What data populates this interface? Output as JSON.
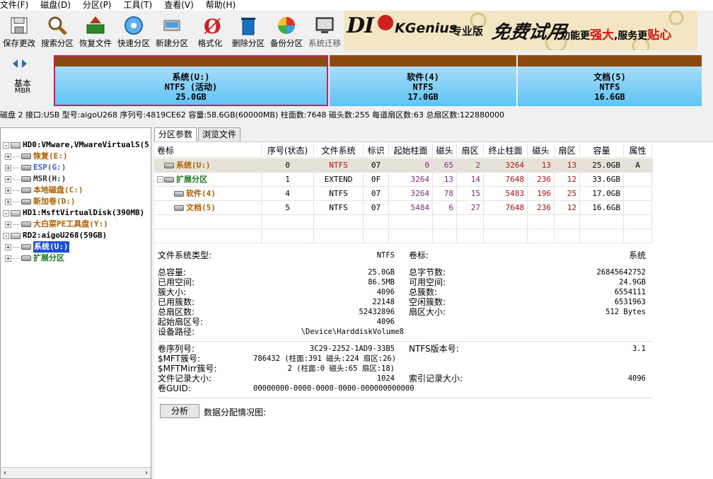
{
  "menu": [
    "文件(F)",
    "磁盘(D)",
    "分区(P)",
    "工具(T)",
    "查看(V)",
    "帮助(H)"
  ],
  "toolbar": [
    {
      "label": "保存更改",
      "icon": "save-icon",
      "disabled": false
    },
    {
      "label": "搜索分区",
      "icon": "search-icon",
      "disabled": false
    },
    {
      "label": "恢复文件",
      "icon": "recover-icon",
      "disabled": false
    },
    {
      "label": "快速分区",
      "icon": "quick-partition-icon",
      "disabled": false
    },
    {
      "label": "新建分区",
      "icon": "new-partition-icon",
      "disabled": false
    },
    {
      "label": "格式化",
      "icon": "format-icon",
      "disabled": false
    },
    {
      "label": "删除分区",
      "icon": "delete-icon",
      "disabled": false
    },
    {
      "label": "备份分区",
      "icon": "backup-icon",
      "disabled": false
    },
    {
      "label": "系统迁移",
      "icon": "migrate-icon",
      "disabled": true
    }
  ],
  "banner": {
    "brand_a": "DI",
    "brand_b": "KGenius",
    "edition": "专业版",
    "free": "免费试用",
    "slogan_a": "功能更",
    "slogan_b": "强大",
    "slogan_c": ",服务更",
    "slogan_d": "贴心"
  },
  "disk_type": {
    "line1": "基本",
    "line2": "MBR"
  },
  "partitions": [
    {
      "name": "系统(U:)",
      "fs": "NTFS (活动)",
      "size": "25.0GB",
      "selected": true
    },
    {
      "name": "软件(4)",
      "fs": "NTFS",
      "size": "17.0GB",
      "selected": false
    },
    {
      "name": "文档(5)",
      "fs": "NTFS",
      "size": "16.6GB",
      "selected": false
    }
  ],
  "disk_info": "磁盘 2 接口:USB  型号:aigoU268  序列号:4819CE62  容量:58.6GB(60000MB)  柱面数:7648  磁头数:255  每道扇区数:63  总扇区数:122880000",
  "tree": [
    {
      "text": "HD0:VMware,VMwareVirtualS(5",
      "type": "disk",
      "indent": 0,
      "exp": "-",
      "color": "#000"
    },
    {
      "text": "恢复(E:)",
      "type": "part",
      "indent": 1,
      "exp": "+",
      "color": "#b06000"
    },
    {
      "text": "ESP(G:)",
      "type": "part",
      "indent": 1,
      "exp": "+",
      "color": "#3a62d8"
    },
    {
      "text": "MSR(H:)",
      "type": "part",
      "indent": 1,
      "exp": "+",
      "color": "#333"
    },
    {
      "text": "本地磁盘(C:)",
      "type": "part",
      "indent": 1,
      "exp": "+",
      "color": "#b06000"
    },
    {
      "text": "新加卷(D:)",
      "type": "part",
      "indent": 1,
      "exp": "+",
      "color": "#b06000"
    },
    {
      "text": "HD1:MsftVirtualDisk(390MB)",
      "type": "disk",
      "indent": 0,
      "exp": "-",
      "color": "#000"
    },
    {
      "text": "大白菜PE工具盘(Y:)",
      "type": "part",
      "indent": 1,
      "exp": "+",
      "color": "#b06000"
    },
    {
      "text": "RD2:aigoU268(59GB)",
      "type": "disk",
      "indent": 0,
      "exp": "-",
      "color": "#000"
    },
    {
      "text": "系统(U:)",
      "type": "part",
      "indent": 1,
      "exp": "+",
      "color": "#fff",
      "selected": true
    },
    {
      "text": "扩展分区",
      "type": "part",
      "indent": 1,
      "exp": "+",
      "color": "#1a7a1a"
    }
  ],
  "tabs": [
    "分区参数",
    "浏览文件"
  ],
  "table": {
    "headers": [
      "卷标",
      "序号(状态)",
      "文件系统",
      "标识",
      "起始柱面",
      "磁头",
      "扇区",
      "终止柱面",
      "磁头",
      "扇区",
      "容量",
      "属性"
    ],
    "rows": [
      {
        "label": "系统(U:)",
        "indent": 0,
        "seq": "0",
        "fs": "NTFS",
        "id": "07",
        "sc": "0",
        "sh": "65",
        "ss": "2",
        "ec": "3264",
        "eh": "13",
        "es": "13",
        "cap": "25.0GB",
        "attr": "A",
        "color": "#b06000",
        "selected": true
      },
      {
        "label": "扩展分区",
        "indent": 0,
        "seq": "1",
        "fs": "EXTEND",
        "id": "0F",
        "sc": "3264",
        "sh": "13",
        "ss": "14",
        "ec": "7648",
        "eh": "236",
        "es": "12",
        "cap": "33.6GB",
        "attr": "",
        "color": "#1a7a1a",
        "selected": false
      },
      {
        "label": "软件(4)",
        "indent": 1,
        "seq": "4",
        "fs": "NTFS",
        "id": "07",
        "sc": "3264",
        "sh": "78",
        "ss": "15",
        "ec": "5483",
        "eh": "196",
        "es": "25",
        "cap": "17.0GB",
        "attr": "",
        "color": "#b06000",
        "selected": false
      },
      {
        "label": "文档(5)",
        "indent": 1,
        "seq": "5",
        "fs": "NTFS",
        "id": "07",
        "sc": "5484",
        "sh": "6",
        "ss": "27",
        "ec": "7648",
        "eh": "236",
        "es": "12",
        "cap": "16.6GB",
        "attr": "",
        "color": "#b06000",
        "selected": false
      }
    ]
  },
  "details": {
    "fs_type_label": "文件系统类型:",
    "fs_type": "NTFS",
    "vol_label_label": "卷标:",
    "vol_label": "系统",
    "left": [
      {
        "k": "总容量:",
        "v": "25.0GB"
      },
      {
        "k": "已用空间:",
        "v": "86.5MB"
      },
      {
        "k": "簇大小:",
        "v": "4096"
      },
      {
        "k": "已用簇数:",
        "v": "22148"
      },
      {
        "k": "总扇区数:",
        "v": "52432896"
      },
      {
        "k": "起始扇区号:",
        "v": "4096"
      },
      {
        "k": "设备路径:",
        "v": "\\Device\\HarddiskVolume8"
      }
    ],
    "right": [
      {
        "k": "总字节数:",
        "v": "26845642752"
      },
      {
        "k": "可用空间:",
        "v": "24.9GB"
      },
      {
        "k": "总簇数:",
        "v": "6554111"
      },
      {
        "k": "空闲簇数:",
        "v": "6531963"
      },
      {
        "k": "扇区大小:",
        "v": "512 Bytes"
      }
    ],
    "left2": [
      {
        "k": "卷序列号:",
        "v": "3C29-2252-1AD9-33B5"
      },
      {
        "k": "$MFT簇号:",
        "v": "786432 (柱面:391 磁头:224 扇区:26)"
      },
      {
        "k": "$MFTMirr簇号:",
        "v": "2 (柱面:0 磁头:65 扇区:18)"
      },
      {
        "k": "文件记录大小:",
        "v": "1024"
      },
      {
        "k": "卷GUID:",
        "v": "00000000-0000-0000-0000-000000000000"
      }
    ],
    "ntfs_ver_label": "NTFS版本号:",
    "ntfs_ver": "3.1",
    "index_label": "索引记录大小:",
    "index_size": "4096",
    "analyze": "分析",
    "dist_label": "数据分配情况图:"
  }
}
